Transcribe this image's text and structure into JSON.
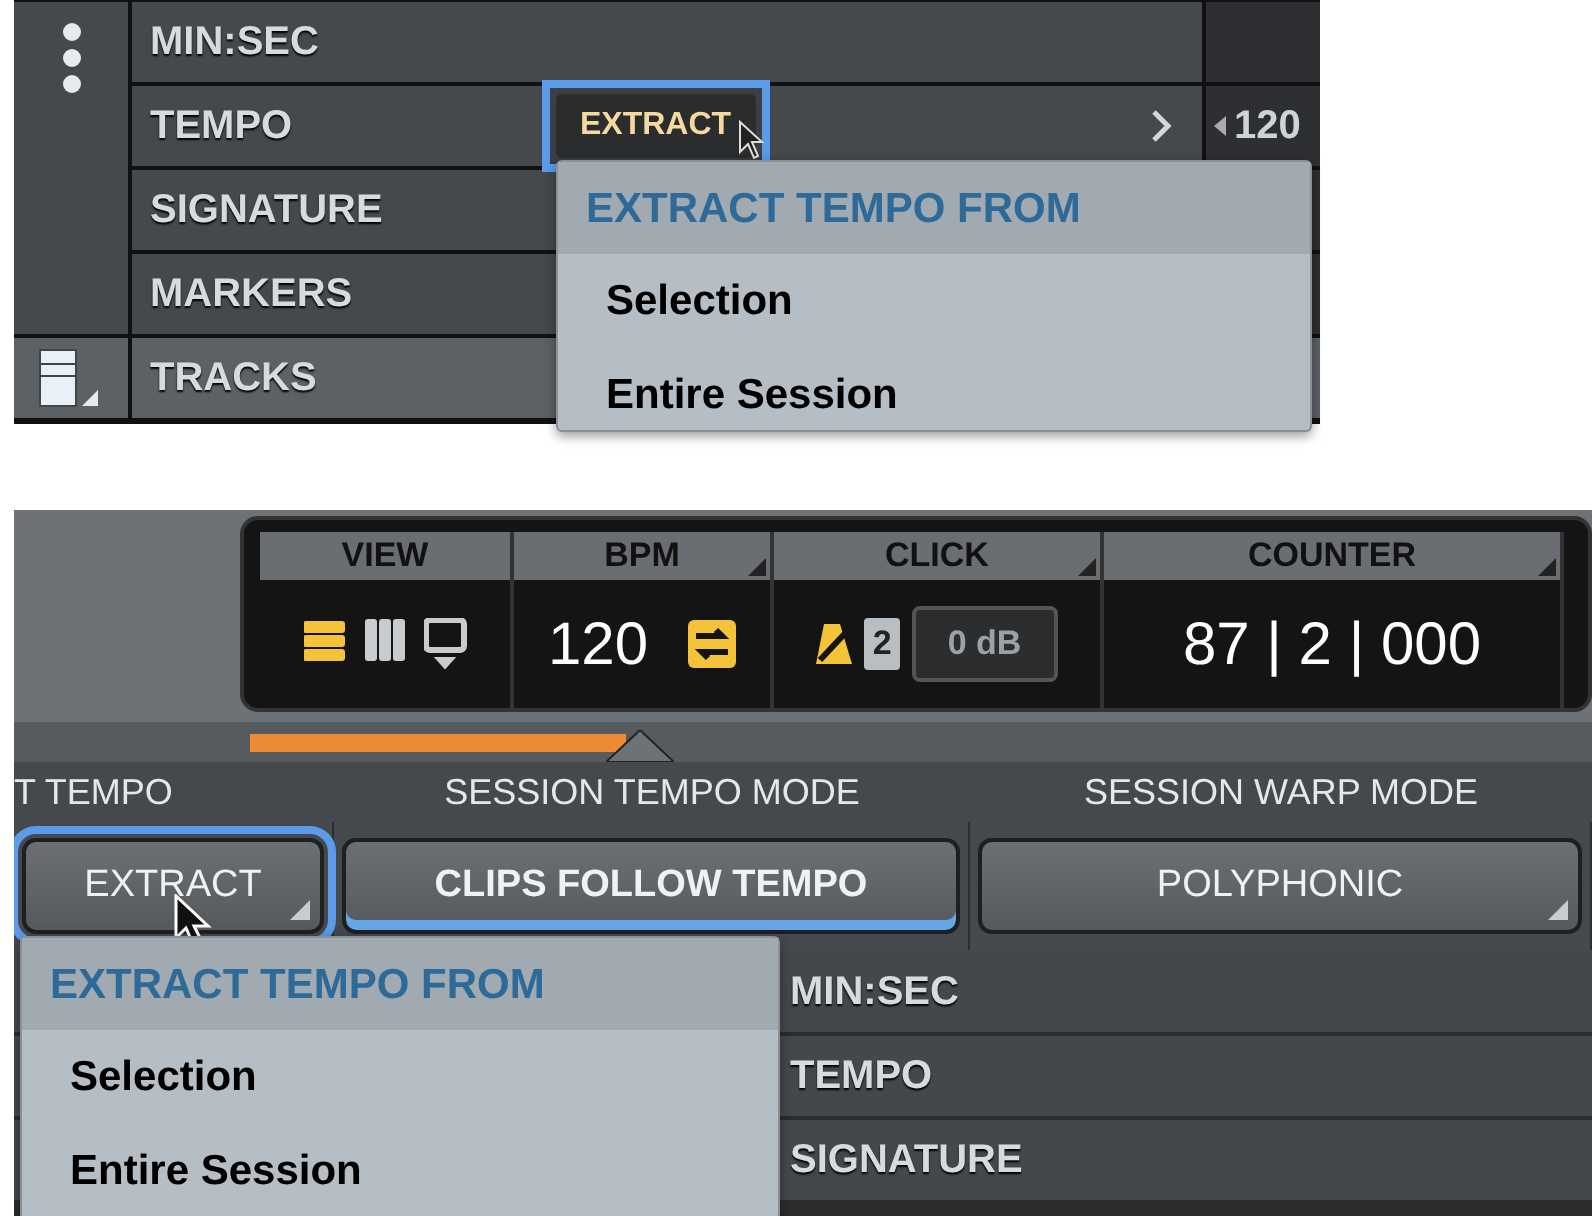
{
  "ruler_panel": {
    "rulers": [
      {
        "label": "MIN:SEC"
      },
      {
        "label": "TEMPO",
        "side_value": "120",
        "extract_button": {
          "label": "EXTRACT",
          "selected": true
        }
      },
      {
        "label": "SIGNATURE"
      },
      {
        "label": "MARKERS"
      }
    ],
    "tracks_label": "TRACKS",
    "menu": {
      "title": "EXTRACT TEMPO FROM",
      "items": [
        "Selection",
        "Entire Session"
      ]
    }
  },
  "transport_panel": {
    "sections": [
      {
        "kind": "view",
        "title": "VIEW",
        "buttons": [
          {
            "selected": true
          },
          {
            "selected": false
          },
          {
            "selected": false
          }
        ]
      },
      {
        "kind": "bpm",
        "title": "BPM",
        "value": "120",
        "sync_on": true
      },
      {
        "kind": "click",
        "title": "CLICK",
        "metronome_on": true,
        "count_in": "2",
        "level": "0 dB"
      },
      {
        "kind": "counter",
        "title": "COUNTER",
        "value": "87 | 2 | 000"
      }
    ],
    "tempo_headers": [
      "T TEMPO",
      "SESSION TEMPO MODE",
      "SESSION WARP MODE"
    ],
    "tempo_buttons": [
      {
        "label": "EXTRACT",
        "selected": true,
        "on": false,
        "dropdown": true
      },
      {
        "label": "CLIPS FOLLOW TEMPO",
        "selected": false,
        "on": true,
        "dropdown": false
      },
      {
        "label": "POLYPHONIC",
        "selected": false,
        "on": false,
        "dropdown": true
      }
    ],
    "rulers": [
      "MIN:SEC",
      "TEMPO",
      "SIGNATURE"
    ],
    "menu": {
      "title": "EXTRACT TEMPO FROM",
      "items": [
        "Selection",
        "Entire Session"
      ]
    }
  }
}
